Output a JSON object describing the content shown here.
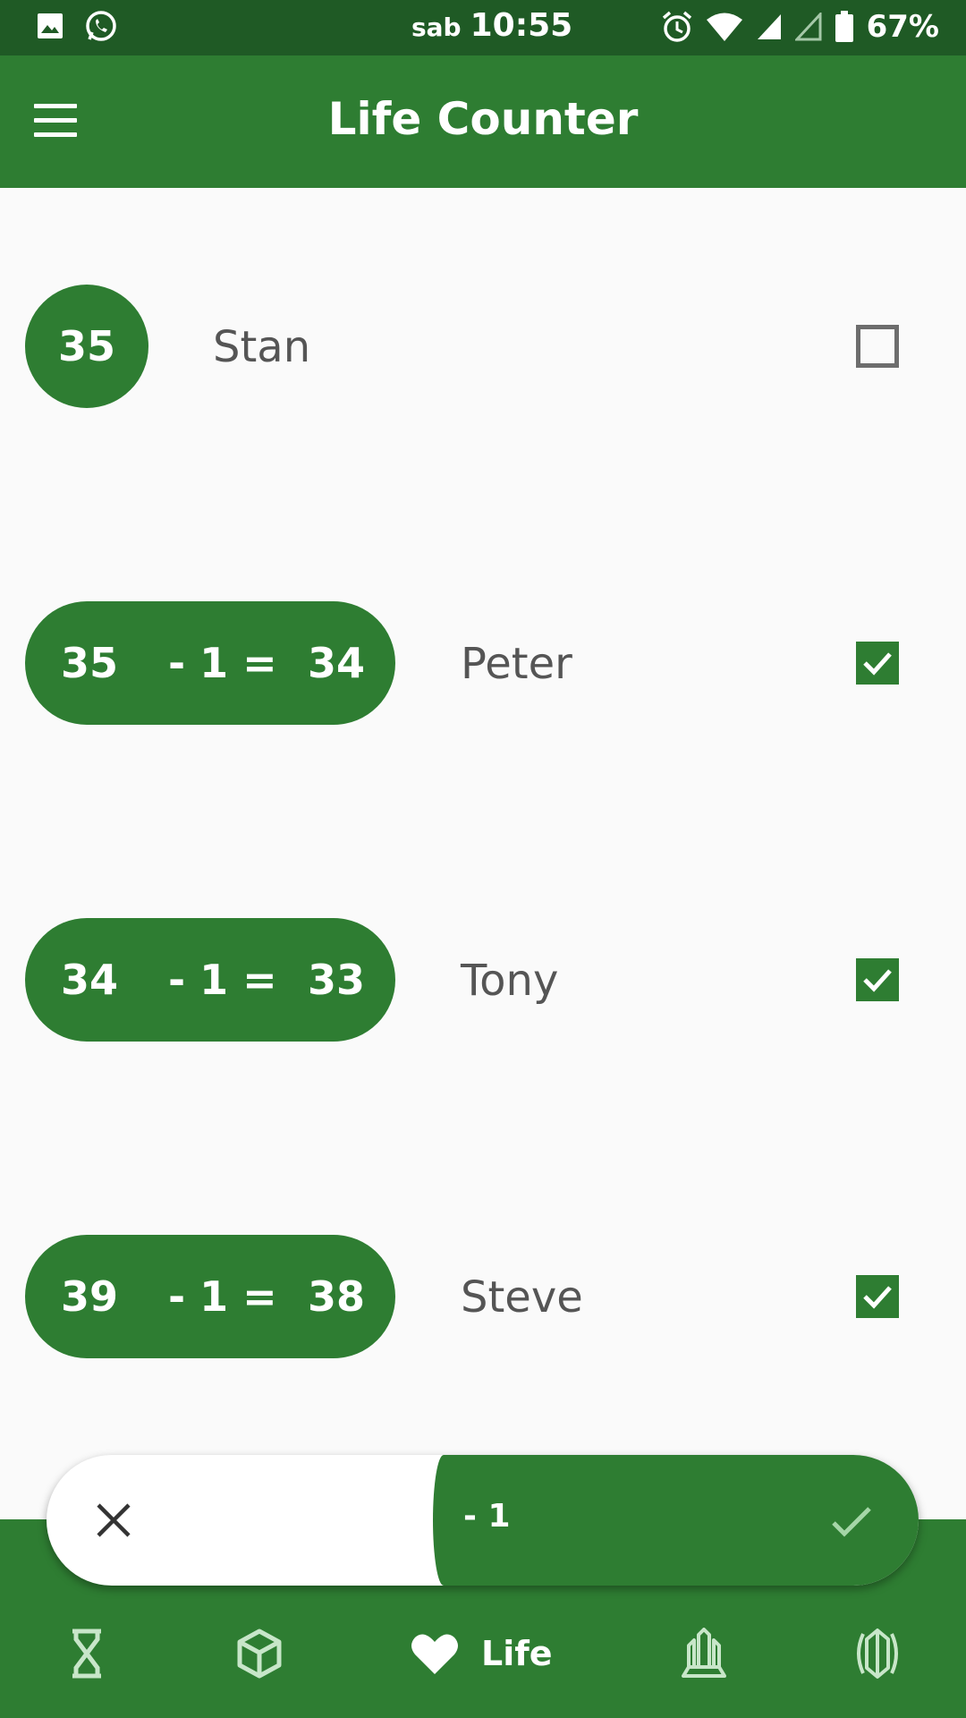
{
  "status_bar": {
    "day": "sab",
    "time": "10:55",
    "battery": "67%",
    "icons": [
      "gallery-icon",
      "whatsapp-icon",
      "alarm-icon",
      "wifi-icon",
      "signal-icon",
      "signal-empty-icon",
      "battery-icon"
    ]
  },
  "app_bar": {
    "title": "Life Counter",
    "menu_icon": "hamburger-menu-icon"
  },
  "players": [
    {
      "name": "Stan",
      "life": "35",
      "checked": false
    },
    {
      "name": "Peter",
      "old": "35",
      "op": "- 1 =",
      "new": "34",
      "checked": true
    },
    {
      "name": "Tony",
      "old": "34",
      "op": "- 1 =",
      "new": "33",
      "checked": true
    },
    {
      "name": "Steve",
      "old": "39",
      "op": "- 1 =",
      "new": "38",
      "checked": true
    }
  ],
  "action_bar": {
    "value": "- 1",
    "cancel_icon": "close-icon",
    "confirm_icon": "check-icon"
  },
  "bottom_nav": {
    "active_label": "Life",
    "items": [
      "hourglass-icon",
      "cube-icon",
      "heart-icon",
      "monument-icon",
      "crest-icon"
    ]
  },
  "colors": {
    "primary": "#2e7d32",
    "status_bar": "#1f5a25",
    "text_secondary": "#555555",
    "background": "#fafafa"
  }
}
